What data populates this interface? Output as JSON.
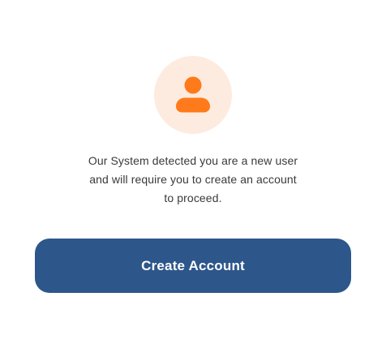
{
  "icon": "user-icon",
  "colors": {
    "avatar_background": "#fdebdf",
    "avatar_icon": "#ff7a1a",
    "button_background": "#2d568b",
    "button_text": "#ffffff",
    "message_text": "#3a3a3a"
  },
  "message": {
    "line1": "Our System detected you are a new user",
    "line2": "and will require you to create an account",
    "line3": "to proceed."
  },
  "actions": {
    "create_account_label": "Create Account"
  }
}
